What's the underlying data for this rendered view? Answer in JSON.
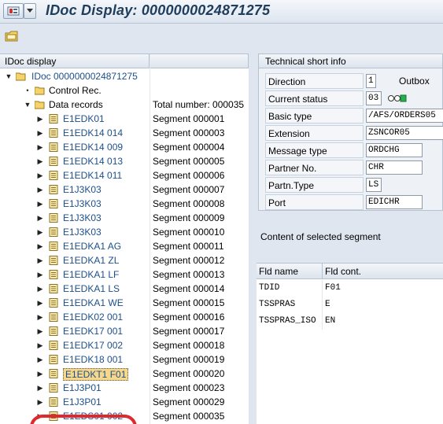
{
  "window": {
    "title": "IDoc Display: 0000000024871275"
  },
  "tree": {
    "col1_header": "IDoc display",
    "col2_header": "",
    "root_label": "IDoc 0000000024871275",
    "control_rec": "Control Rec.",
    "data_records": "Data records",
    "total_number": "Total number: 000035",
    "segments": [
      {
        "name": "E1EDK01",
        "segment": "Segment 000001"
      },
      {
        "name": "E1EDK14 014",
        "segment": "Segment 000003"
      },
      {
        "name": "E1EDK14 009",
        "segment": "Segment 000004"
      },
      {
        "name": "E1EDK14 013",
        "segment": "Segment 000005"
      },
      {
        "name": "E1EDK14 011",
        "segment": "Segment 000006"
      },
      {
        "name": "E1J3K03",
        "segment": "Segment 000007"
      },
      {
        "name": "E1J3K03",
        "segment": "Segment 000008"
      },
      {
        "name": "E1J3K03",
        "segment": "Segment 000009"
      },
      {
        "name": "E1J3K03",
        "segment": "Segment 000010"
      },
      {
        "name": "E1EDKA1 AG",
        "segment": "Segment 000011"
      },
      {
        "name": "E1EDKA1 ZL",
        "segment": "Segment 000012"
      },
      {
        "name": "E1EDKA1 LF",
        "segment": "Segment 000013"
      },
      {
        "name": "E1EDKA1 LS",
        "segment": "Segment 000014"
      },
      {
        "name": "E1EDKA1 WE",
        "segment": "Segment 000015"
      },
      {
        "name": "E1EDK02 001",
        "segment": "Segment 000016"
      },
      {
        "name": "E1EDK17 001",
        "segment": "Segment 000017"
      },
      {
        "name": "E1EDK17 002",
        "segment": "Segment 000018"
      },
      {
        "name": "E1EDK18 001",
        "segment": "Segment 000019"
      },
      {
        "name": "E1EDKT1 F01",
        "segment": "Segment 000020"
      },
      {
        "name": "E1J3P01",
        "segment": "Segment 000023"
      },
      {
        "name": "E1J3P01",
        "segment": "Segment 000029"
      },
      {
        "name": "E1EDS01 002",
        "segment": "Segment 000035"
      }
    ]
  },
  "tech_info": {
    "title": "Technical short info",
    "direction_label": "Direction",
    "direction_value": "1",
    "direction_text": "Outbox",
    "status_label": "Current status",
    "status_value": "03",
    "basic_type_label": "Basic type",
    "basic_type_value": "/AFS/ORDERS05",
    "extension_label": "Extension",
    "extension_value": "ZSNCOR05",
    "message_type_label": "Message type",
    "message_type_value": "ORDCHG",
    "partner_no_label": "Partner No.",
    "partner_no_value": "CHR",
    "partn_type_label": "Partn.Type",
    "partn_type_value": "LS",
    "port_label": "Port",
    "port_value": "EDICHR"
  },
  "segment_content": {
    "title": "Content of selected segment",
    "col_field": "Fld name",
    "col_content": "Fld cont.",
    "rows": [
      {
        "field": "TDID",
        "value": "F01"
      },
      {
        "field": "TSSPRAS",
        "value": "E"
      },
      {
        "field": "TSSPRAS_ISO",
        "value": "EN"
      }
    ]
  },
  "colors": {
    "highlight_circle": "#e0282f",
    "selected_bg": "#f7d88a",
    "link_blue": "#1c4f8c",
    "status_green": "#22b14c"
  }
}
